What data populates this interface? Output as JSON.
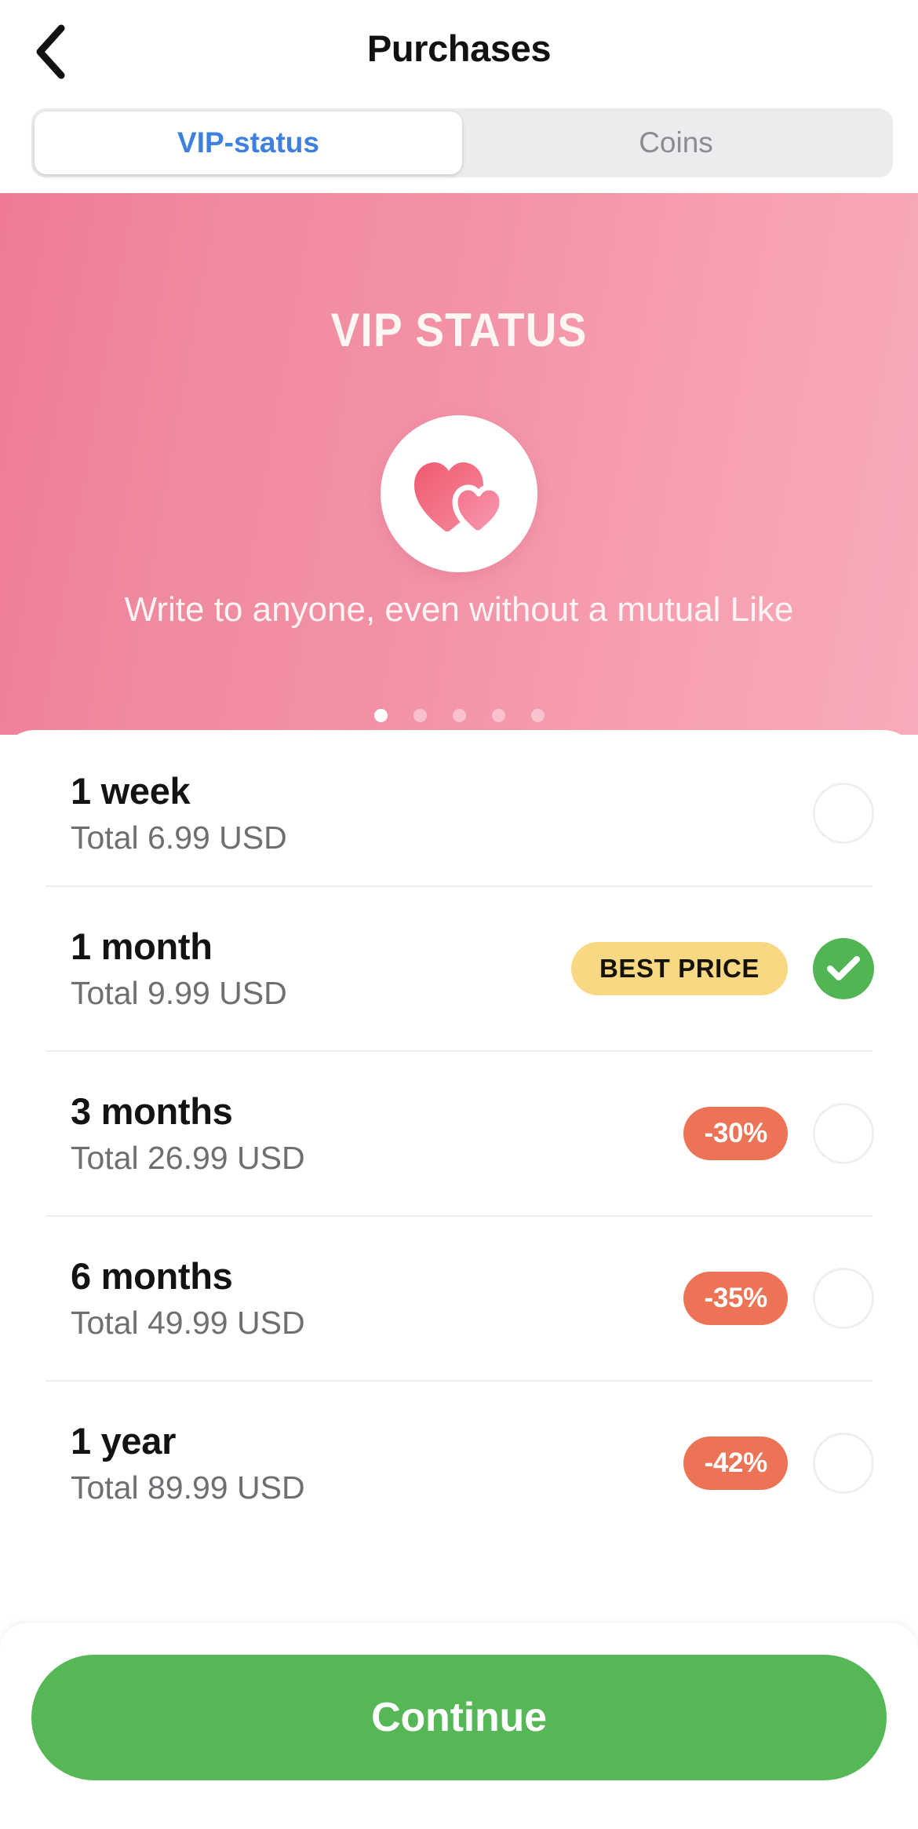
{
  "header": {
    "title": "Purchases",
    "back_icon": "chevron-left-icon"
  },
  "tabs": [
    {
      "label": "VIP-status",
      "active": true
    },
    {
      "label": "Coins",
      "active": false
    }
  ],
  "banner": {
    "title": "VIP STATUS",
    "subtitle": "Write to anyone, even without a mutual Like",
    "icon": "two-hearts-icon",
    "gradient_from": "#f07a94",
    "gradient_to": "#f8abba",
    "dots_total": 5,
    "dots_active_index": 0
  },
  "plans": [
    {
      "title": "1 week",
      "total": "Total 6.99 USD",
      "badge": null,
      "badge_type": null,
      "selected": false
    },
    {
      "title": "1 month",
      "total": "Total 9.99 USD",
      "badge": "BEST PRICE",
      "badge_type": "best",
      "selected": true
    },
    {
      "title": "3 months",
      "total": "Total 26.99 USD",
      "badge": "-30%",
      "badge_type": "discount",
      "selected": false
    },
    {
      "title": "6 months",
      "total": "Total 49.99 USD",
      "badge": "-35%",
      "badge_type": "discount",
      "selected": false
    },
    {
      "title": "1 year",
      "total": "Total 89.99 USD",
      "badge": "-42%",
      "badge_type": "discount",
      "selected": false
    }
  ],
  "cta": {
    "label": "Continue"
  },
  "colors": {
    "accent_blue": "#3e7fe0",
    "green": "#55b755",
    "badge_yellow": "#f9d884",
    "badge_orange": "#ec7355",
    "pink": "#f08a9e"
  }
}
